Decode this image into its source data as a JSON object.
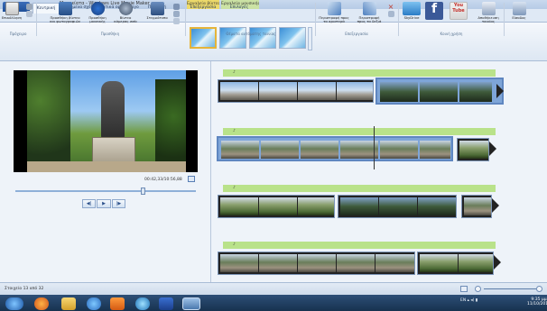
{
  "window": {
    "title": "Μνημείατα - Windows Live Movie Maker",
    "context_groups": [
      "Εργαλεία βίντεο",
      "Εργαλεία μουσικής"
    ]
  },
  "tabs": {
    "file": "▾",
    "items": [
      "Κεντρική",
      "Κινούμενα σχέδια",
      "Οπτικά εφέ",
      "Έργο",
      "Προβολή",
      "Επεξεργασία",
      "Επιλογές"
    ]
  },
  "ribbon": {
    "paste": "Επικόλληση",
    "add_videos": "Προσθήκη βίντεο\nκαι φωτογραφιών",
    "add_music": "Προσθήκη\nμουσικής",
    "webcam": "Βίντεο\nκάμερας web",
    "snapshot": "Στιγμιότυπο",
    "rotate_left": "Περιστροφή προς\nτα αριστερά",
    "rotate_right": "Περιστροφή\nπρος τα δεξιά",
    "skydrive": "SkyDrive",
    "facebook": "f",
    "youtube": "You\nTube",
    "save_movie": "Αποθήκευση\nταινίας",
    "signin": "Είσοδος",
    "groups": {
      "clipboard": "Πρόχειρο",
      "add": "Προσθήκη",
      "themes": "Θέματα αυτόματης ταινίας",
      "editing": "Επεξεργασία",
      "share": "Κοινή χρήση"
    }
  },
  "preview": {
    "timecode": "00:42,33/10:56,88",
    "buttons": {
      "prev": "◀|",
      "play": "▶",
      "next": "|▶"
    },
    "seek_fraction": 0.078
  },
  "storyboard": {
    "rows": [
      {
        "label": "♪"
      },
      {
        "label": "♪"
      },
      {
        "label": "♪"
      },
      {
        "label": "♪"
      }
    ]
  },
  "status": {
    "text": "Στοιχείο 13 από 32"
  },
  "taskbar": {
    "language": "EN",
    "time": "9:35 μμ\n11/10/2014"
  },
  "colors": {
    "accent": "#1f4f97",
    "narration": "#b9e28a",
    "context_video": "#ecd96a",
    "context_music": "#cbe2a4"
  }
}
